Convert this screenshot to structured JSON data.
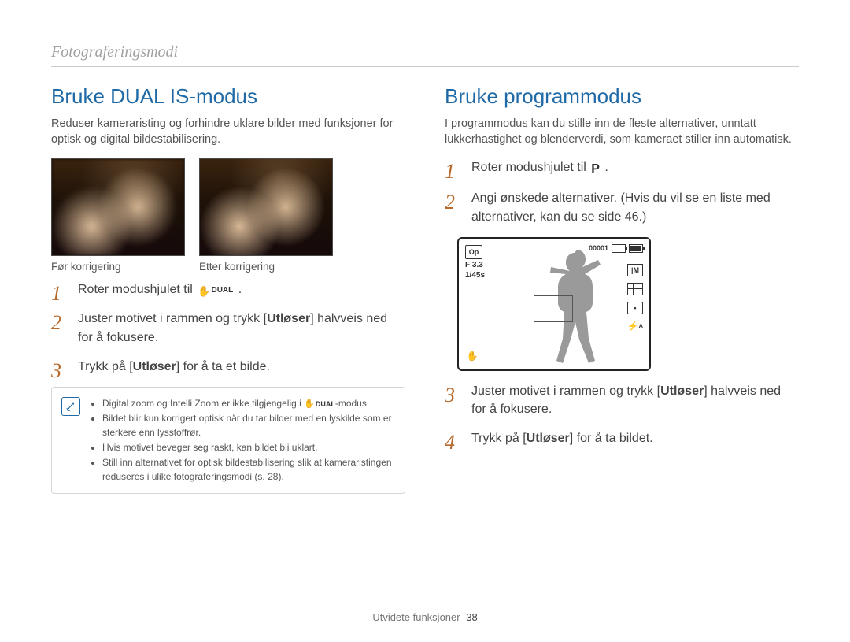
{
  "breadcrumb": "Fotograferingsmodi",
  "footer_label": "Utvidete funksjoner",
  "footer_page": "38",
  "left": {
    "title": "Bruke DUAL IS-modus",
    "intro": "Reduser kameraristing og forhindre uklare bilder med funksjoner for optisk og digital bildestabilisering.",
    "caption_before": "Før korrigering",
    "caption_after": "Etter korrigering",
    "mode_icon_label": "DUAL",
    "steps": {
      "s1_pre": "Roter modushjulet til ",
      "s1_post": ".",
      "s2_a": "Juster motivet i rammen og trykk [",
      "s2_b": "Utløser",
      "s2_c": "] halvveis ned for å fokusere.",
      "s3_a": "Trykk på [",
      "s3_b": "Utløser",
      "s3_c": "] for å ta et bilde."
    },
    "notes": {
      "n1_a": "Digital zoom og Intelli Zoom er ikke tilgjengelig i ",
      "n1_b": "-modus.",
      "n2": "Bildet blir kun korrigert optisk når du tar bilder med en lyskilde som er sterkere enn lysstoffrør.",
      "n3": "Hvis motivet beveger seg raskt, kan bildet bli uklart.",
      "n4": "Still inn alternativet for optisk bildestabilisering slik at kameraristingen reduseres i ulike fotograferingsmodi (s. 28)."
    }
  },
  "right": {
    "title": "Bruke programmodus",
    "intro": "I programmodus kan du stille inn de fleste alternativer, unntatt lukkerhastighet og blenderverdi, som kameraet stiller inn automatisk.",
    "mode_icon_label": "P",
    "steps": {
      "s1_pre": "Roter modushjulet til ",
      "s1_post": ".",
      "s2": "Angi ønskede alternativer. (Hvis du vil se en liste med alternativer, kan du se side 46.)",
      "s3_a": "Juster motivet i rammen og trykk [",
      "s3_b": "Utløser",
      "s3_c": "] halvveis ned for å fokusere.",
      "s4_a": "Trykk på [",
      "s4_b": "Utløser",
      "s4_c": "] for å ta bildet."
    },
    "lcd": {
      "badge": "Op",
      "aperture": "F 3.3",
      "shutter": "1/45s",
      "counter": "00001",
      "res_label": "|M",
      "flash_label": "A"
    }
  }
}
